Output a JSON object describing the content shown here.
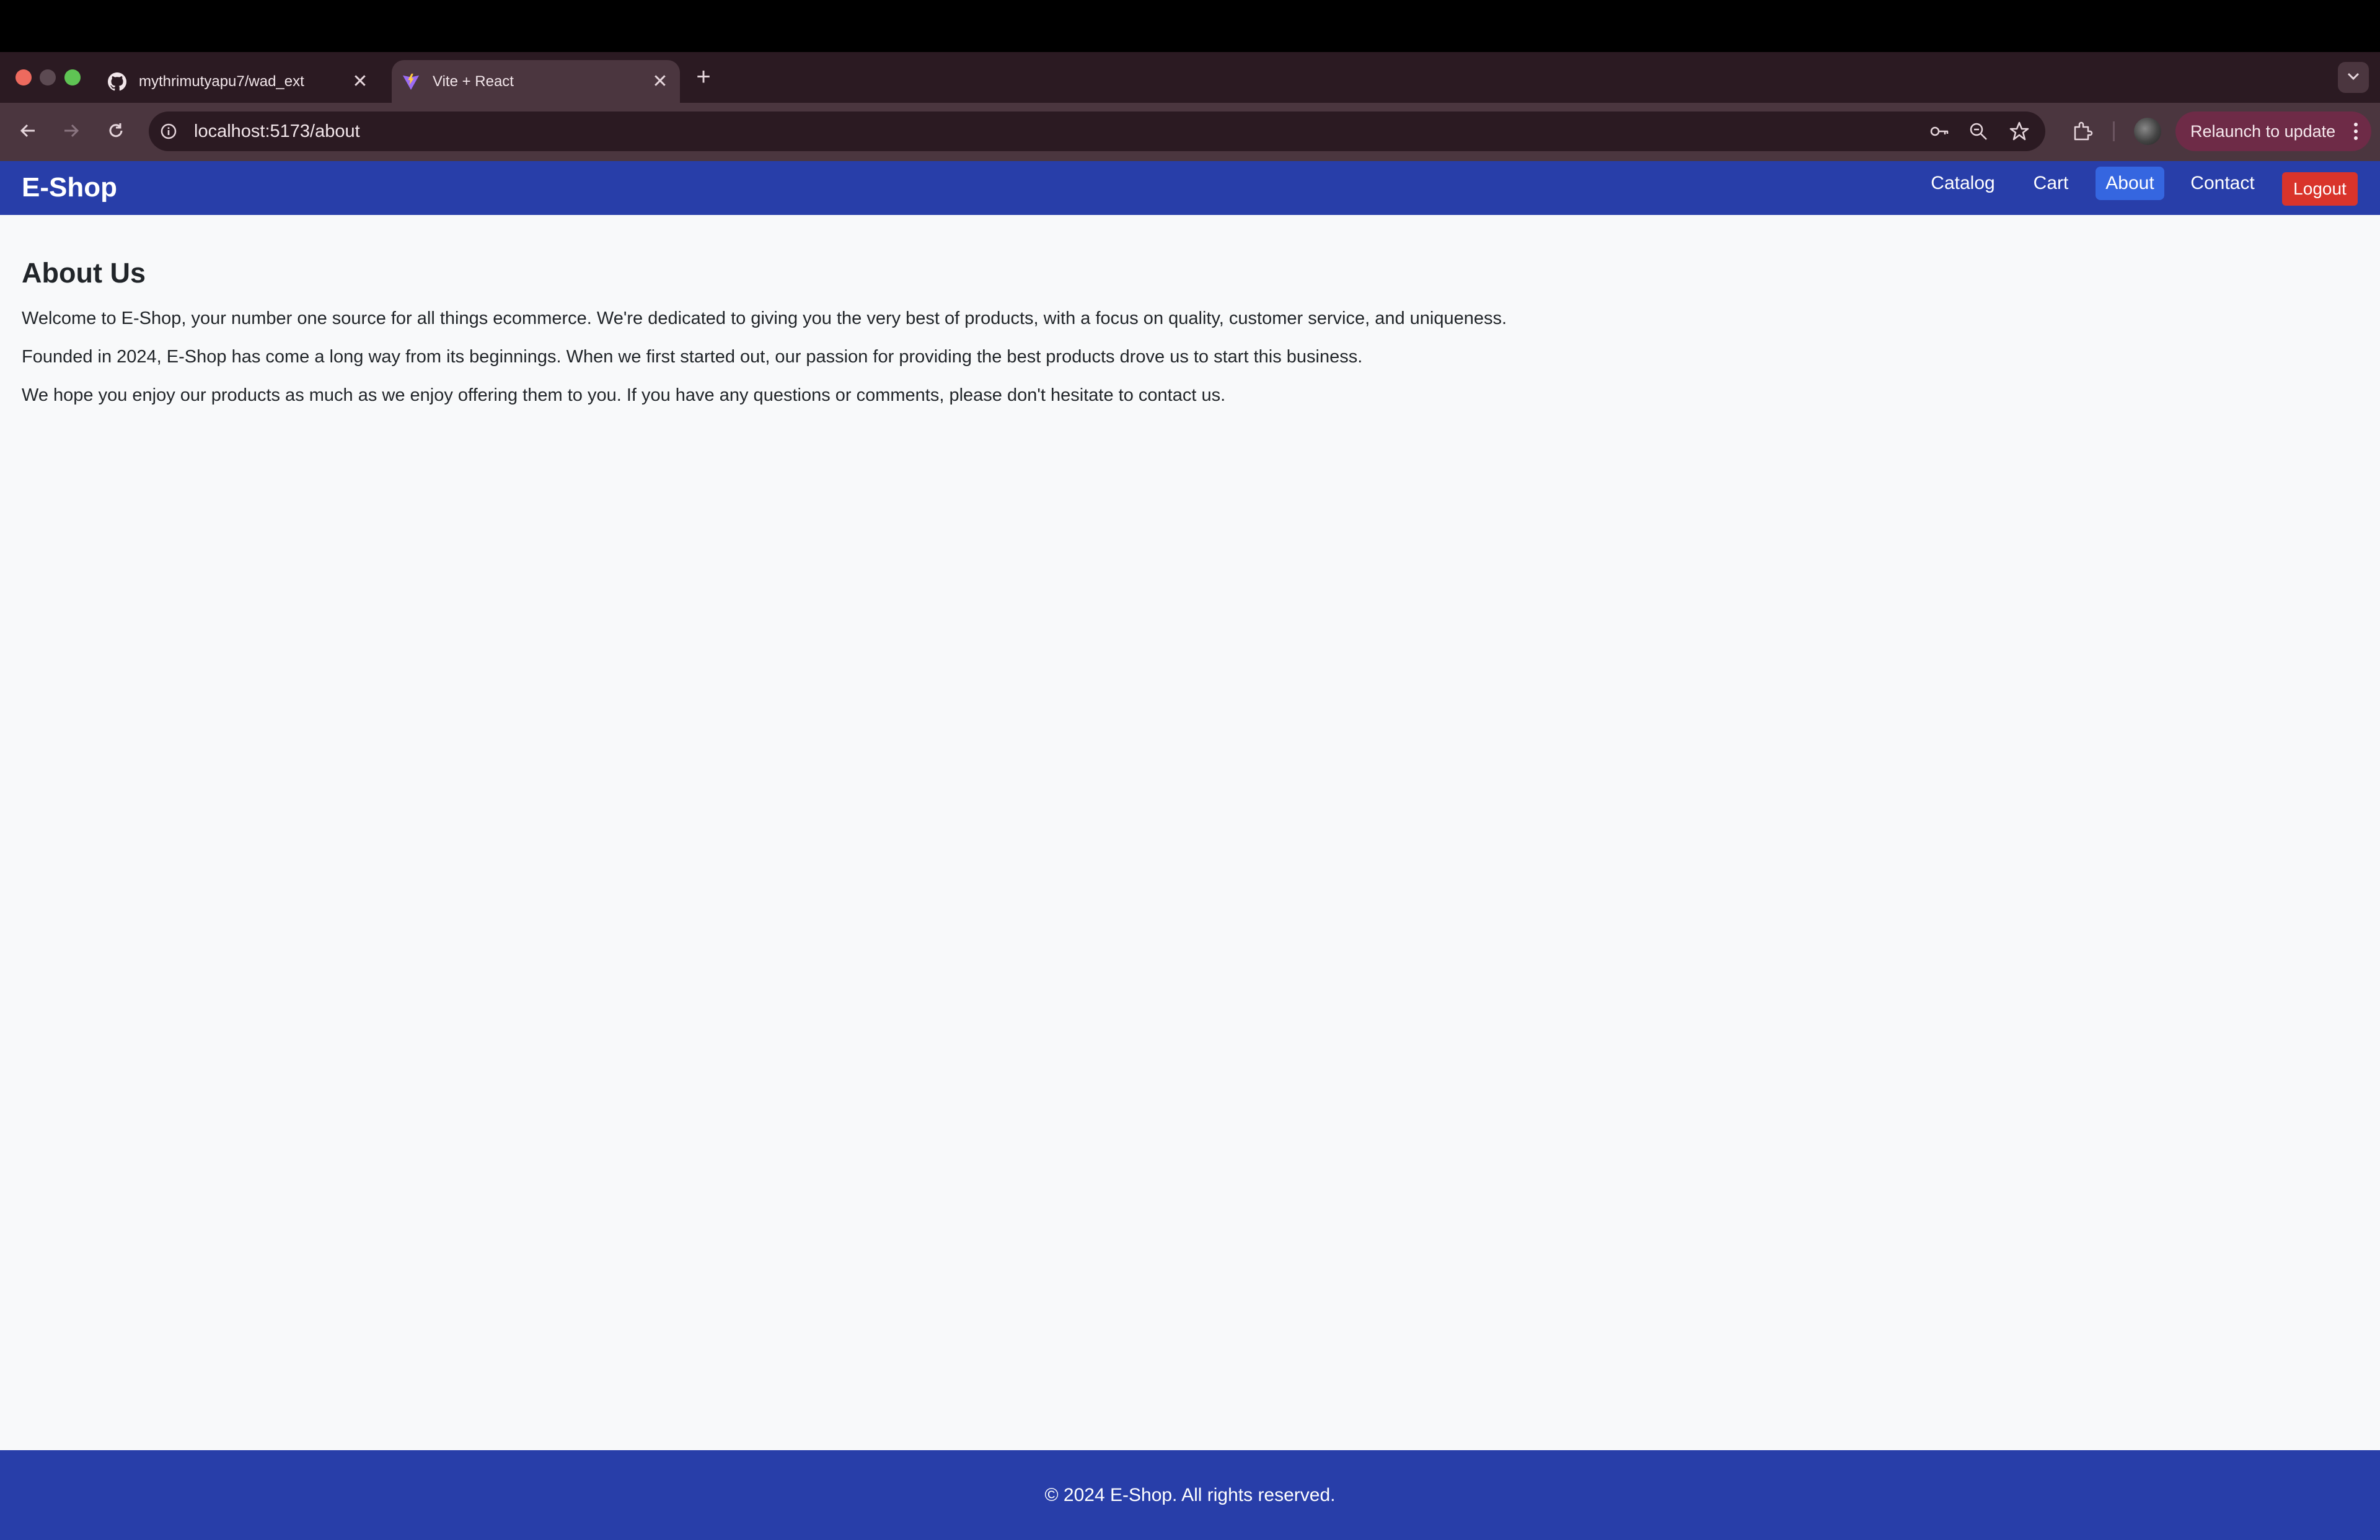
{
  "browser": {
    "tabs": [
      {
        "title": "mythrimutyapu7/wad_ext",
        "favicon": "github-icon",
        "active": false
      },
      {
        "title": "Vite + React",
        "favicon": "vite-icon",
        "active": true
      }
    ],
    "new_tab_symbol": "+",
    "close_symbol": "✕",
    "url": "localhost:5173/about",
    "relaunch_label": "Relaunch to update"
  },
  "site": {
    "brand": "E-Shop",
    "nav": {
      "catalog": "Catalog",
      "cart": "Cart",
      "about": "About",
      "contact": "Contact"
    },
    "logout_label": "Logout",
    "active_nav": "About",
    "colors": {
      "navbar": "#283ea9",
      "active_link": "#3566e0",
      "logout": "#d9342b",
      "page_bg": "#f8f9fa"
    }
  },
  "about": {
    "heading": "About Us",
    "paragraphs": [
      "Welcome to E-Shop, your number one source for all things ecommerce. We're dedicated to giving you the very best of products, with a focus on quality, customer service, and uniqueness.",
      "Founded in 2024, E-Shop has come a long way from its beginnings. When we first started out, our passion for providing the best products drove us to start this business.",
      "We hope you enjoy our products as much as we enjoy offering them to you. If you have any questions or comments, please don't hesitate to contact us."
    ]
  },
  "footer": {
    "text": "© 2024 E-Shop. All rights reserved."
  }
}
